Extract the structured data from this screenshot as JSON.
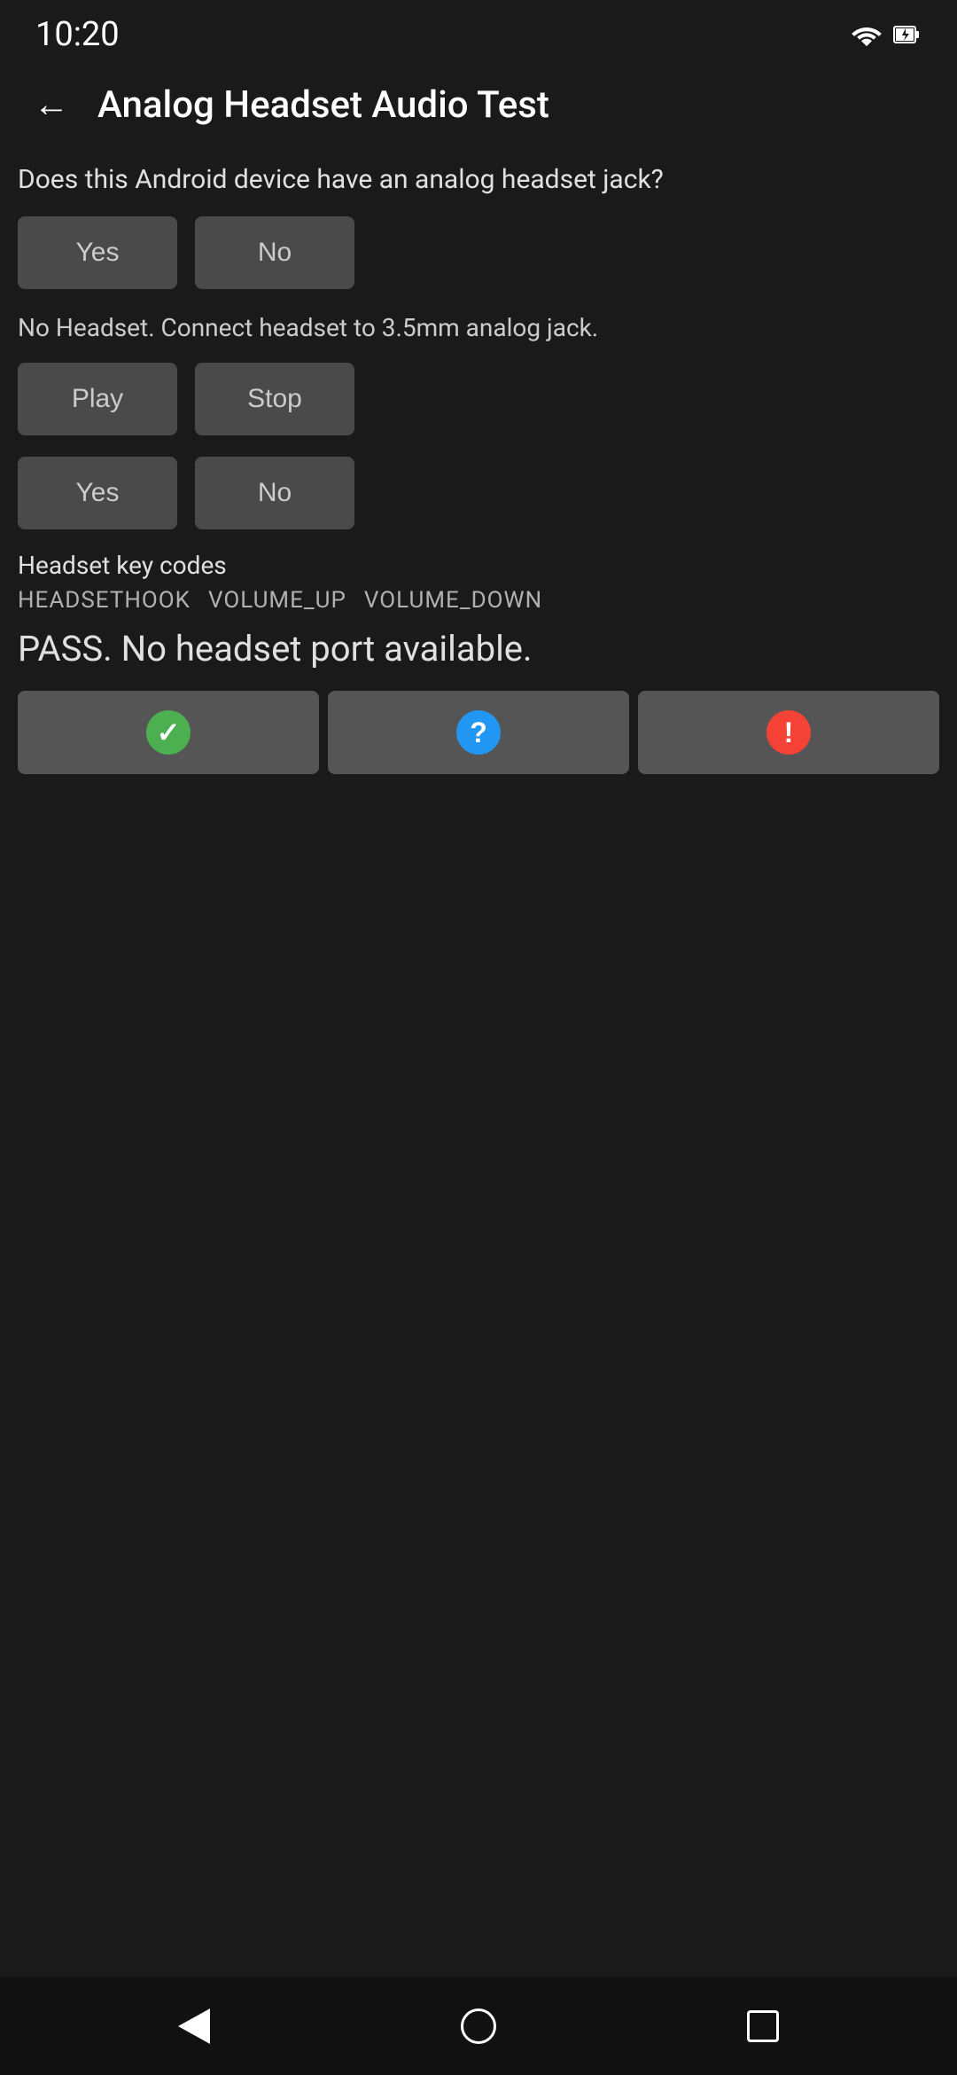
{
  "statusBar": {
    "time": "10:20"
  },
  "header": {
    "title": "Analog Headset Audio Test",
    "backLabel": "←"
  },
  "main": {
    "question": "Does this Android device have an analog headset jack?",
    "yesButton1": "Yes",
    "noButton1": "No",
    "infoText": "No Headset. Connect headset to 3.5mm analog jack.",
    "playButton": "Play",
    "stopButton": "Stop",
    "yesButton2": "Yes",
    "noButton2": "No",
    "keyCodesTitle": "Headset key codes",
    "keyCodes": [
      "HEADSETHOOK",
      "VOLUME_UP",
      "VOLUME_DOWN"
    ],
    "passText": "PASS. No headset port available.",
    "passIconLabel": "✓",
    "infoIconLabel": "?",
    "failIconLabel": "!"
  },
  "navBar": {
    "backLabel": "back",
    "homeLabel": "home",
    "recentLabel": "recent"
  }
}
